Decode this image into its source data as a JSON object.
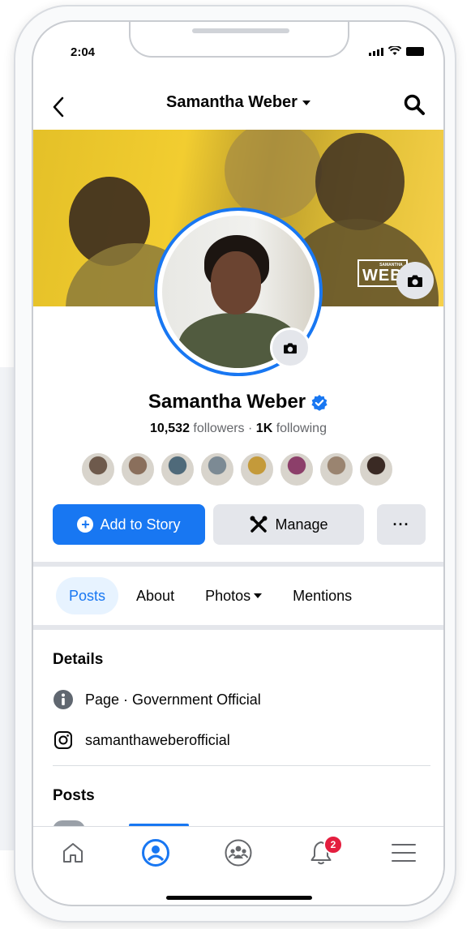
{
  "status_bar": {
    "time": "2:04"
  },
  "header": {
    "title": "Samantha Weber"
  },
  "cover": {
    "badge_small": "SAMANTHA",
    "badge_text": "WEB"
  },
  "profile": {
    "name": "Samantha Weber",
    "followers_count": "10,532",
    "followers_label": "followers",
    "separator": "·",
    "following_count": "1K",
    "following_label": "following"
  },
  "friend_avatar_colors": [
    "#6e5a4c",
    "#8a6f5c",
    "#4f6a7a",
    "#7c8a94",
    "#c49a3a",
    "#8c3f6a",
    "#9a8470",
    "#3a2a24"
  ],
  "actions": {
    "add_story_label": "Add to Story",
    "manage_label": "Manage",
    "more_label": "···"
  },
  "tabs": [
    "Posts",
    "About",
    "Photos",
    "Mentions"
  ],
  "details": {
    "title": "Details",
    "page_type": "Page · Government Official",
    "instagram": "samanthaweberofficial"
  },
  "posts": {
    "title": "Posts"
  },
  "bottom_nav": {
    "notification_count": "2"
  },
  "colors": {
    "accent": "#1877f2",
    "badge": "#e41e3f",
    "cover": "#f2cd30"
  }
}
